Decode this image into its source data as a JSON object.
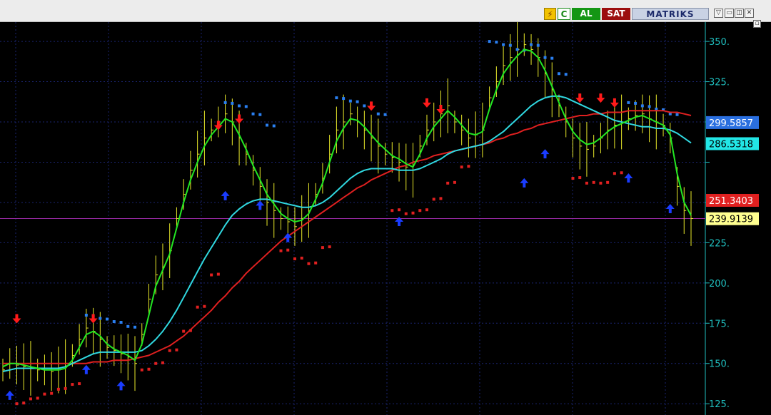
{
  "toolbar": {
    "flash_icon": "⚡",
    "c_label": "C",
    "buy_label": "AL",
    "sell_label": "SAT",
    "brand": "MATRIKS",
    "menu_icon": "▽",
    "minimize_icon": "▭",
    "restore_icon": "◫",
    "close_icon": "✕",
    "sub_icon": "▫"
  },
  "colors": {
    "background": "#000000",
    "grid": "#1a2470",
    "axis": "#1fbfbf",
    "price": "#eaea2a",
    "ma_fast": "#22e822",
    "ma_mid": "#30d8e0",
    "ma_slow": "#e02020",
    "sar_up": "#e02020",
    "sar_down": "#2a7ff0",
    "buy_arrow": "#1a3cff",
    "sell_arrow": "#ff1a1a"
  },
  "chart_data": {
    "type": "line",
    "ylim": [
      118,
      362
    ],
    "y_ticks": [
      125,
      150,
      175,
      200,
      225,
      250,
      275,
      300,
      325,
      350
    ],
    "y_tick_labels": [
      "125.",
      "150.",
      "175.",
      "200.",
      "225.",
      "",
      "",
      "",
      "325.",
      "350."
    ],
    "x_count": 100,
    "series": [
      {
        "key": "price",
        "values": [
          146,
          150,
          149,
          148,
          147,
          146,
          146,
          145,
          146,
          148,
          155,
          165,
          172,
          170,
          165,
          160,
          158,
          156,
          154,
          150,
          168,
          190,
          205,
          210,
          220,
          240,
          255,
          270,
          280,
          290,
          295,
          300,
          305,
          300,
          290,
          280,
          270,
          260,
          250,
          245,
          240,
          238,
          235,
          240,
          245,
          255,
          265,
          280,
          295,
          300,
          305,
          300,
          295,
          290,
          285,
          280,
          278,
          275,
          272,
          270,
          285,
          295,
          300,
          305,
          310,
          300,
          295,
          290,
          292,
          295,
          315,
          325,
          335,
          340,
          345,
          348,
          345,
          340,
          330,
          320,
          310,
          300,
          290,
          285,
          283,
          285,
          290,
          295,
          298,
          300,
          302,
          304,
          305,
          302,
          300,
          298,
          290,
          260,
          245,
          240
        ]
      },
      {
        "key": "ma_fast",
        "values": [
          148,
          150,
          150,
          149,
          148,
          147,
          146,
          146,
          146,
          147,
          152,
          160,
          168,
          170,
          167,
          162,
          159,
          157,
          155,
          152,
          162,
          180,
          198,
          208,
          218,
          234,
          250,
          264,
          275,
          285,
          292,
          297,
          302,
          300,
          292,
          283,
          273,
          264,
          255,
          249,
          243,
          240,
          238,
          239,
          243,
          252,
          262,
          275,
          288,
          296,
          302,
          301,
          297,
          292,
          287,
          283,
          279,
          277,
          274,
          272,
          280,
          290,
          297,
          302,
          307,
          303,
          298,
          293,
          292,
          294,
          308,
          320,
          330,
          336,
          341,
          345,
          344,
          340,
          332,
          322,
          312,
          302,
          294,
          289,
          286,
          287,
          290,
          294,
          297,
          299,
          301,
          303,
          304,
          302,
          300,
          298,
          292,
          268,
          250,
          242
        ]
      },
      {
        "key": "ma_mid",
        "values": [
          145,
          146,
          147,
          147,
          147,
          147,
          147,
          147,
          147,
          148,
          150,
          152,
          154,
          156,
          157,
          157,
          157,
          157,
          157,
          157,
          158,
          161,
          165,
          170,
          176,
          183,
          191,
          199,
          207,
          215,
          222,
          229,
          236,
          242,
          246,
          249,
          251,
          252,
          252,
          251,
          250,
          249,
          248,
          247,
          247,
          248,
          250,
          253,
          257,
          261,
          265,
          268,
          270,
          271,
          271,
          271,
          271,
          270,
          270,
          270,
          271,
          273,
          275,
          277,
          280,
          282,
          283,
          284,
          285,
          286,
          288,
          291,
          294,
          298,
          302,
          306,
          310,
          313,
          315,
          316,
          316,
          315,
          313,
          311,
          309,
          307,
          305,
          303,
          301,
          300,
          299,
          298,
          297,
          297,
          296,
          296,
          295,
          293,
          290,
          287
        ]
      },
      {
        "key": "ma_slow",
        "values": [
          150,
          150,
          150,
          150,
          150,
          150,
          150,
          150,
          150,
          150,
          150,
          150,
          150,
          151,
          151,
          151,
          152,
          152,
          152,
          153,
          154,
          155,
          157,
          159,
          161,
          164,
          167,
          171,
          175,
          179,
          183,
          188,
          192,
          197,
          201,
          206,
          210,
          214,
          218,
          222,
          226,
          229,
          232,
          235,
          238,
          241,
          244,
          247,
          250,
          253,
          256,
          259,
          261,
          264,
          266,
          268,
          270,
          272,
          273,
          275,
          276,
          277,
          279,
          280,
          281,
          282,
          283,
          284,
          285,
          286,
          287,
          289,
          290,
          292,
          293,
          295,
          296,
          298,
          299,
          300,
          301,
          302,
          303,
          304,
          304,
          305,
          305,
          306,
          306,
          306,
          307,
          307,
          307,
          307,
          307,
          307,
          306,
          306,
          305,
          304
        ]
      }
    ],
    "sar_points": [
      {
        "i": 2,
        "v": 125,
        "c": "up"
      },
      {
        "i": 4,
        "v": 128,
        "c": "up"
      },
      {
        "i": 6,
        "v": 131,
        "c": "up"
      },
      {
        "i": 8,
        "v": 134,
        "c": "up"
      },
      {
        "i": 10,
        "v": 137,
        "c": "up"
      },
      {
        "i": 12,
        "v": 180,
        "c": "down"
      },
      {
        "i": 14,
        "v": 178,
        "c": "down"
      },
      {
        "i": 16,
        "v": 176,
        "c": "down"
      },
      {
        "i": 18,
        "v": 173,
        "c": "down"
      },
      {
        "i": 20,
        "v": 146,
        "c": "up"
      },
      {
        "i": 22,
        "v": 150,
        "c": "up"
      },
      {
        "i": 24,
        "v": 158,
        "c": "up"
      },
      {
        "i": 26,
        "v": 170,
        "c": "up"
      },
      {
        "i": 28,
        "v": 185,
        "c": "up"
      },
      {
        "i": 30,
        "v": 205,
        "c": "up"
      },
      {
        "i": 32,
        "v": 312,
        "c": "down"
      },
      {
        "i": 34,
        "v": 310,
        "c": "down"
      },
      {
        "i": 36,
        "v": 305,
        "c": "down"
      },
      {
        "i": 38,
        "v": 298,
        "c": "down"
      },
      {
        "i": 40,
        "v": 220,
        "c": "up"
      },
      {
        "i": 42,
        "v": 215,
        "c": "up"
      },
      {
        "i": 44,
        "v": 212,
        "c": "up"
      },
      {
        "i": 46,
        "v": 222,
        "c": "up"
      },
      {
        "i": 48,
        "v": 315,
        "c": "down"
      },
      {
        "i": 50,
        "v": 313,
        "c": "down"
      },
      {
        "i": 52,
        "v": 310,
        "c": "down"
      },
      {
        "i": 54,
        "v": 305,
        "c": "down"
      },
      {
        "i": 56,
        "v": 245,
        "c": "up"
      },
      {
        "i": 58,
        "v": 243,
        "c": "up"
      },
      {
        "i": 60,
        "v": 245,
        "c": "up"
      },
      {
        "i": 62,
        "v": 252,
        "c": "up"
      },
      {
        "i": 64,
        "v": 262,
        "c": "up"
      },
      {
        "i": 66,
        "v": 272,
        "c": "up"
      },
      {
        "i": 70,
        "v": 350,
        "c": "down"
      },
      {
        "i": 72,
        "v": 348,
        "c": "down"
      },
      {
        "i": 74,
        "v": 345,
        "c": "down"
      },
      {
        "i": 76,
        "v": 348,
        "c": "down"
      },
      {
        "i": 78,
        "v": 340,
        "c": "down"
      },
      {
        "i": 80,
        "v": 330,
        "c": "down"
      },
      {
        "i": 82,
        "v": 265,
        "c": "up"
      },
      {
        "i": 84,
        "v": 262,
        "c": "up"
      },
      {
        "i": 86,
        "v": 262,
        "c": "up"
      },
      {
        "i": 88,
        "v": 268,
        "c": "up"
      },
      {
        "i": 90,
        "v": 312,
        "c": "down"
      },
      {
        "i": 92,
        "v": 310,
        "c": "down"
      },
      {
        "i": 94,
        "v": 308,
        "c": "down"
      },
      {
        "i": 96,
        "v": 305,
        "c": "down"
      }
    ],
    "signals": [
      {
        "i": 1,
        "v": 130,
        "type": "buy"
      },
      {
        "i": 2,
        "v": 178,
        "type": "sell"
      },
      {
        "i": 12,
        "v": 146,
        "type": "buy"
      },
      {
        "i": 13,
        "v": 178,
        "type": "sell"
      },
      {
        "i": 17,
        "v": 136,
        "type": "buy"
      },
      {
        "i": 31,
        "v": 298,
        "type": "sell"
      },
      {
        "i": 32,
        "v": 254,
        "type": "buy"
      },
      {
        "i": 34,
        "v": 302,
        "type": "sell"
      },
      {
        "i": 37,
        "v": 248,
        "type": "buy"
      },
      {
        "i": 41,
        "v": 228,
        "type": "buy"
      },
      {
        "i": 53,
        "v": 310,
        "type": "sell"
      },
      {
        "i": 57,
        "v": 238,
        "type": "buy"
      },
      {
        "i": 61,
        "v": 312,
        "type": "sell"
      },
      {
        "i": 63,
        "v": 308,
        "type": "sell"
      },
      {
        "i": 75,
        "v": 262,
        "type": "buy"
      },
      {
        "i": 78,
        "v": 280,
        "type": "buy"
      },
      {
        "i": 83,
        "v": 315,
        "type": "sell"
      },
      {
        "i": 86,
        "v": 315,
        "type": "sell"
      },
      {
        "i": 88,
        "v": 312,
        "type": "sell"
      },
      {
        "i": 90,
        "v": 265,
        "type": "buy"
      },
      {
        "i": 96,
        "v": 246,
        "type": "buy"
      }
    ],
    "h_line": 240,
    "value_labels": [
      {
        "text": "299.5857",
        "v": 299.6,
        "bg": "#2a6fe0",
        "fg": "#ffffff"
      },
      {
        "text": "286.5318",
        "v": 286.5,
        "bg": "#22e6e6",
        "fg": "#000000"
      },
      {
        "text": "251.3403",
        "v": 251.3,
        "bg": "#e02020",
        "fg": "#ffffff"
      },
      {
        "text": "239.9139",
        "v": 239.9,
        "bg": "#ffff90",
        "fg": "#000000"
      }
    ]
  }
}
